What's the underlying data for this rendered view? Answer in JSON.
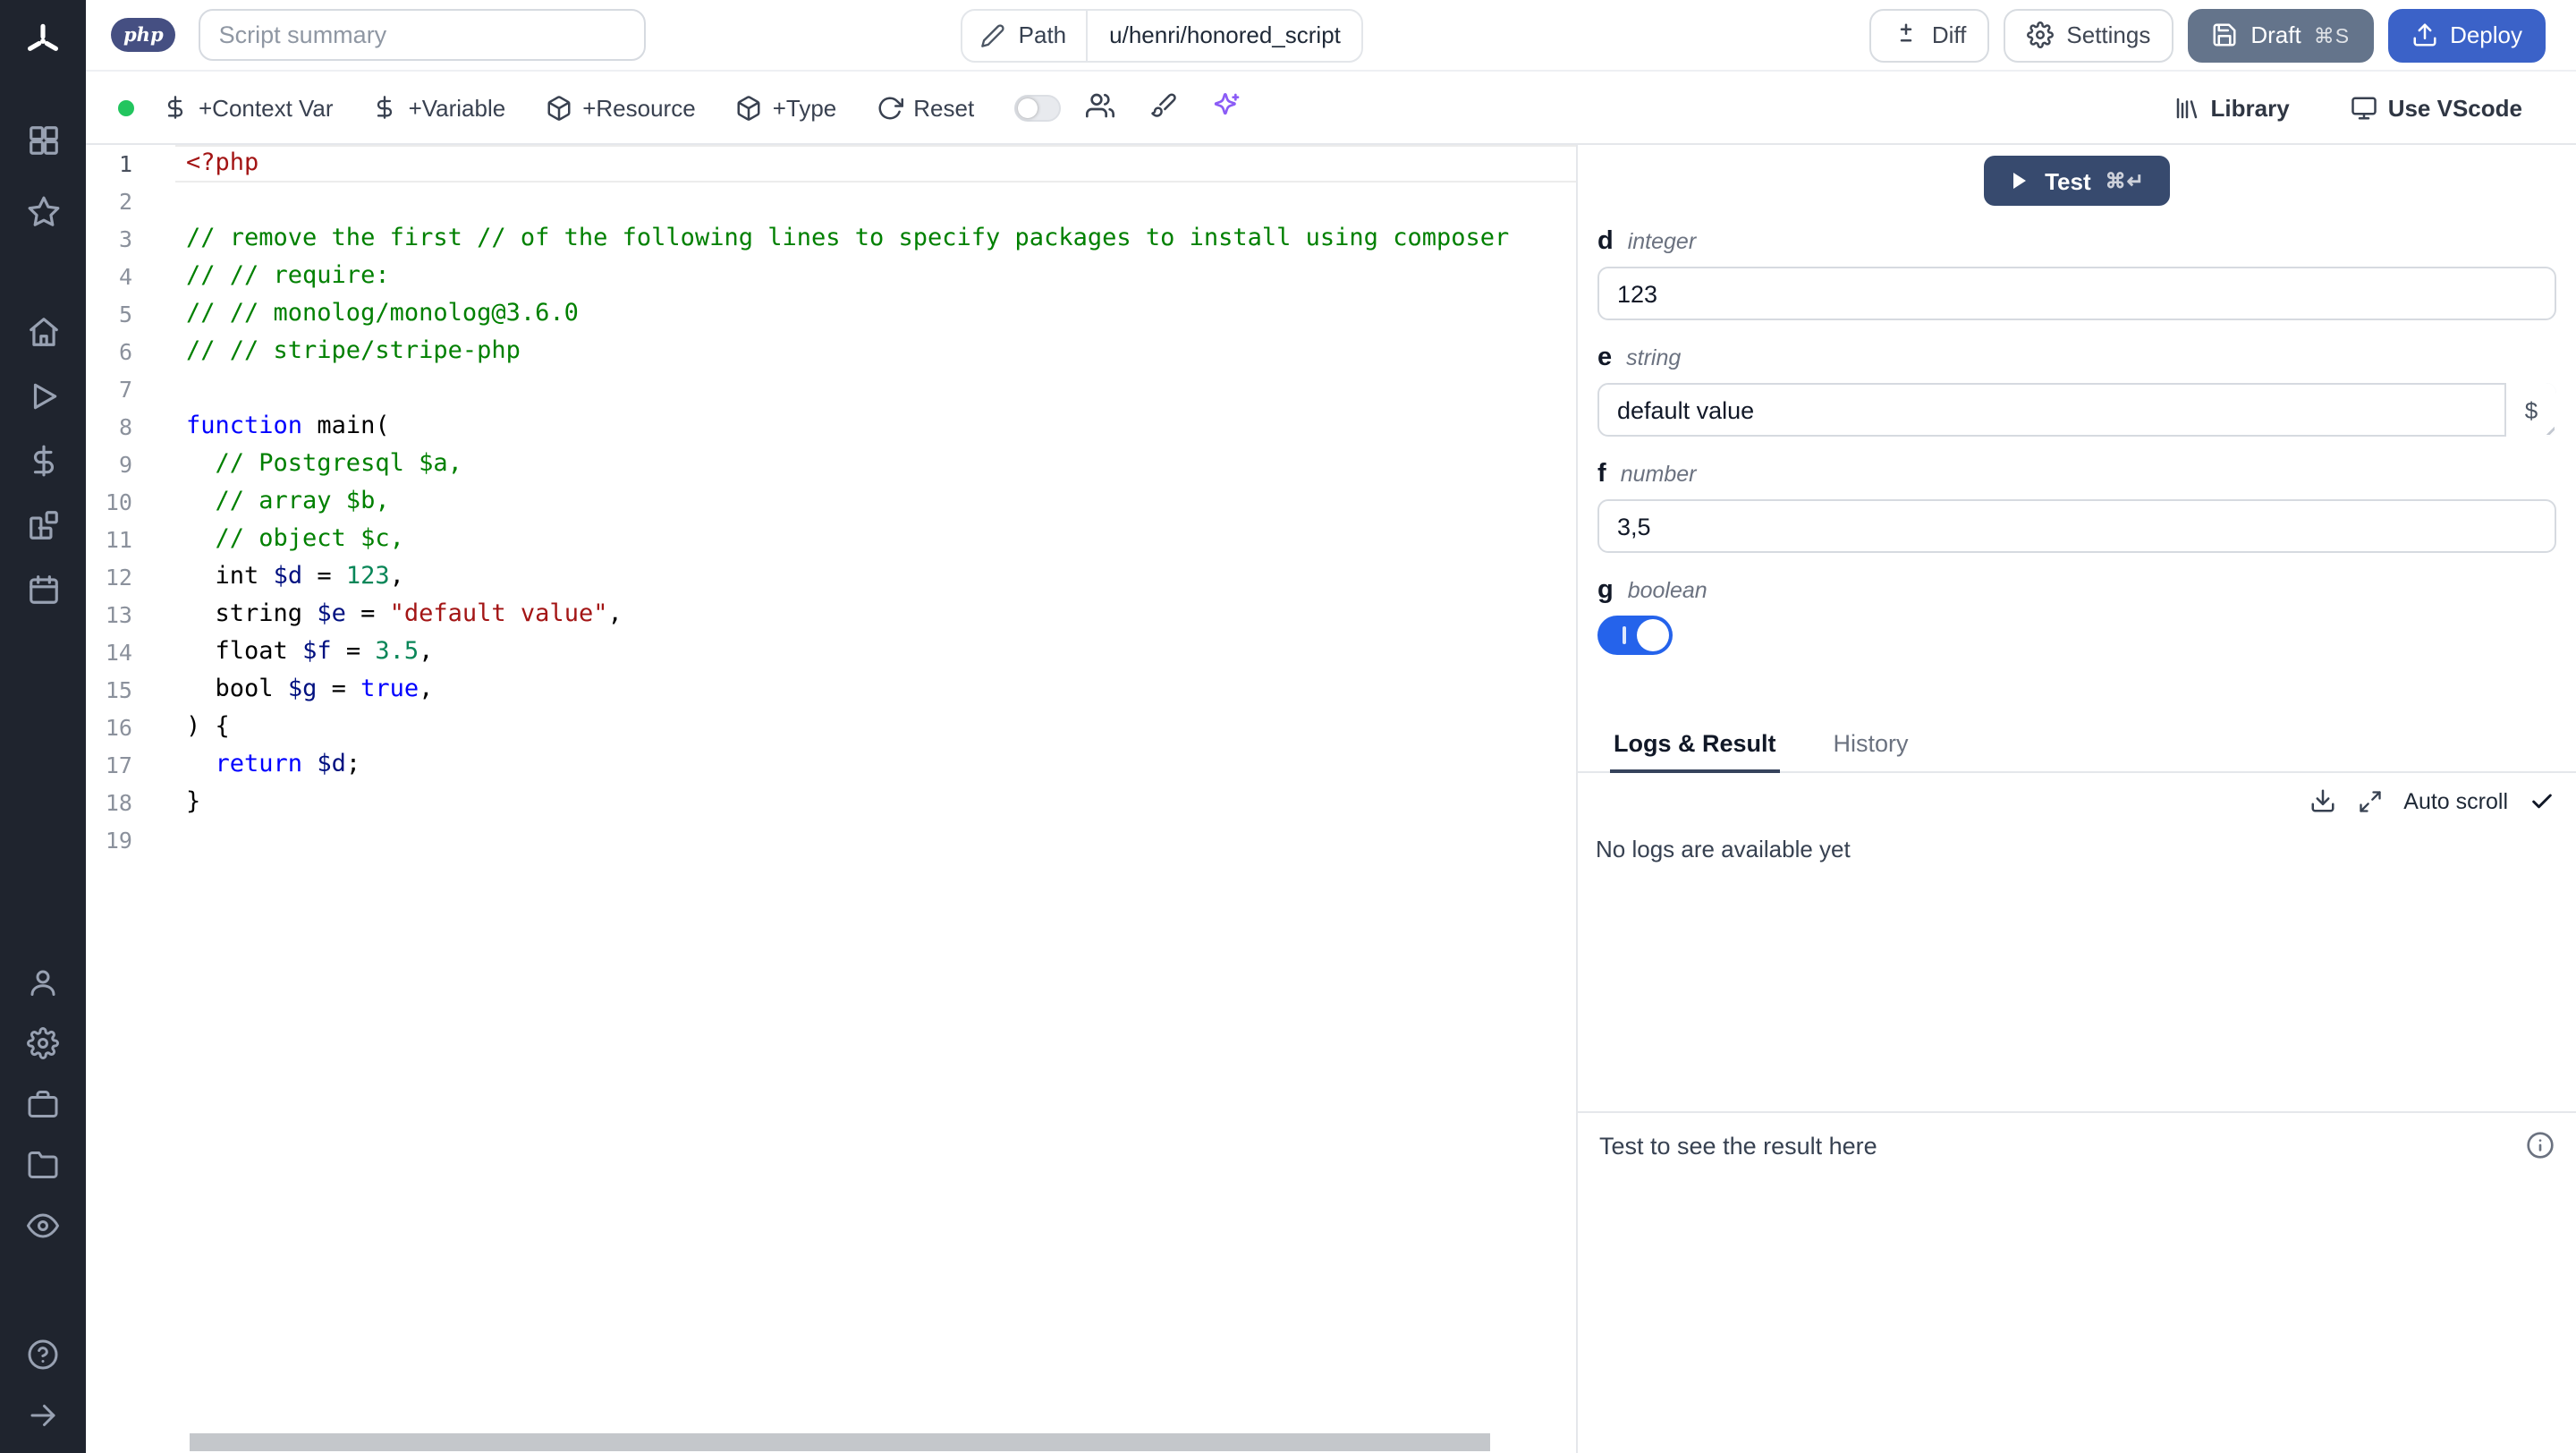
{
  "topbar": {
    "language_badge": "php",
    "summary_placeholder": "Script summary",
    "path": {
      "label": "Path",
      "value": "u/henri/honored_script"
    },
    "buttons": {
      "diff": "Diff",
      "settings": "Settings",
      "draft": "Draft",
      "draft_shortcut": "⌘S",
      "deploy": "Deploy"
    }
  },
  "toolbar": {
    "status_color": "#22c55e",
    "add_context_var": "+Context Var",
    "add_variable": "+Variable",
    "add_resource": "+Resource",
    "add_type": "+Type",
    "reset": "Reset",
    "library": "Library",
    "use_vscode": "Use VScode",
    "ai_color": "#8b5cf6"
  },
  "sidebar": {
    "top_icons": [
      "grid-icon",
      "star-icon"
    ],
    "nav_icons": [
      "home-icon",
      "play-icon",
      "dollar-icon",
      "blocks-icon",
      "calendar-icon"
    ],
    "lower_icons": [
      "user-icon",
      "settings-icon",
      "briefcase-icon",
      "folder-icon",
      "eye-icon"
    ],
    "bottom_icons": [
      "help-icon",
      "arrow-right-icon"
    ]
  },
  "editor": {
    "language": "php",
    "active_line": 1,
    "lines": [
      {
        "num": 1,
        "tokens": [
          [
            "<?php",
            "m"
          ]
        ]
      },
      {
        "num": 2,
        "tokens": []
      },
      {
        "num": 3,
        "tokens": [
          [
            "// remove the first // of the following lines to specify packages to install using composer",
            "c"
          ]
        ]
      },
      {
        "num": 4,
        "tokens": [
          [
            "// // require:",
            "c"
          ]
        ]
      },
      {
        "num": 5,
        "tokens": [
          [
            "// // monolog/monolog@3.6.0",
            "c"
          ]
        ]
      },
      {
        "num": 6,
        "tokens": [
          [
            "// // stripe/stripe-php",
            "c"
          ]
        ]
      },
      {
        "num": 7,
        "tokens": []
      },
      {
        "num": 8,
        "tokens": [
          [
            "function",
            "k"
          ],
          [
            " main(",
            "p"
          ]
        ]
      },
      {
        "num": 9,
        "tokens": [
          [
            "  // Postgresql $a,",
            "c"
          ]
        ]
      },
      {
        "num": 10,
        "tokens": [
          [
            "  // array $b,",
            "c"
          ]
        ]
      },
      {
        "num": 11,
        "tokens": [
          [
            "  // object $c,",
            "c"
          ]
        ]
      },
      {
        "num": 12,
        "tokens": [
          [
            "  int ",
            "p"
          ],
          [
            "$d",
            "v"
          ],
          [
            " = ",
            "p"
          ],
          [
            "123",
            "n"
          ],
          [
            ",",
            "p"
          ]
        ]
      },
      {
        "num": 13,
        "tokens": [
          [
            "  string ",
            "p"
          ],
          [
            "$e",
            "v"
          ],
          [
            " = ",
            "p"
          ],
          [
            "\"default value\"",
            "s"
          ],
          [
            ",",
            "p"
          ]
        ]
      },
      {
        "num": 14,
        "tokens": [
          [
            "  float ",
            "p"
          ],
          [
            "$f",
            "v"
          ],
          [
            " = ",
            "p"
          ],
          [
            "3.5",
            "n"
          ],
          [
            ",",
            "p"
          ]
        ]
      },
      {
        "num": 15,
        "tokens": [
          [
            "  bool ",
            "p"
          ],
          [
            "$g",
            "v"
          ],
          [
            " = ",
            "p"
          ],
          [
            "true",
            "k"
          ],
          [
            ",",
            "p"
          ]
        ]
      },
      {
        "num": 16,
        "tokens": [
          [
            ") {",
            "p"
          ]
        ]
      },
      {
        "num": 17,
        "tokens": [
          [
            "  ",
            "p"
          ],
          [
            "return",
            "k"
          ],
          [
            " ",
            "p"
          ],
          [
            "$d",
            "v"
          ],
          [
            ";",
            "p"
          ]
        ]
      },
      {
        "num": 18,
        "tokens": [
          [
            "}",
            "p"
          ]
        ]
      },
      {
        "num": 19,
        "tokens": []
      }
    ]
  },
  "preview": {
    "test": {
      "label": "Test",
      "shortcut": "⌘↵"
    },
    "fields": [
      {
        "name": "d",
        "type": "integer",
        "value": "123",
        "kind": "input"
      },
      {
        "name": "e",
        "type": "string",
        "value": "default value",
        "kind": "input-dollar"
      },
      {
        "name": "f",
        "type": "number",
        "value": "3,5",
        "kind": "input"
      },
      {
        "name": "g",
        "type": "boolean",
        "value": true,
        "kind": "toggle"
      }
    ],
    "tabs": {
      "items": [
        "Logs & Result",
        "History"
      ],
      "active": "Logs & Result"
    },
    "logs": {
      "auto_scroll": "Auto scroll",
      "empty": "No logs are available yet"
    },
    "result": {
      "placeholder": "Test to see the result here"
    }
  }
}
